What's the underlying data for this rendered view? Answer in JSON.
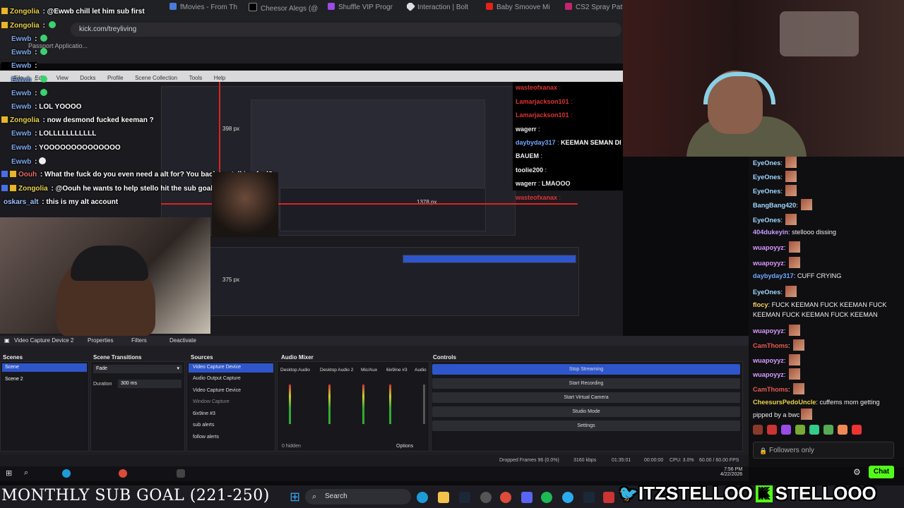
{
  "browser": {
    "tabs": [
      "fMovies - From Th",
      "Cheesor Alegs (@",
      "Shuffle VIP Progr",
      "Interaction | Bolt",
      "Baby Smoove Mi",
      "CS2 Spray Pattern"
    ],
    "url": "kick.com/treyliving",
    "bookmark": "Passport Applicatio..."
  },
  "obs_inner_menu": [
    "File",
    "Edit",
    "View",
    "Docks",
    "Profile",
    "Scene Collection",
    "Tools",
    "Help"
  ],
  "overlay_chat": [
    {
      "user": "Zongolia",
      "sep": " : ",
      "msg": "@Ewwb chill let him sub first",
      "color": "#e8d24a",
      "badge": "yellow"
    },
    {
      "user": "Zongolia",
      "sep": " : ",
      "msg": "",
      "color": "#e8d24a",
      "badge": "yellow"
    },
    {
      "user": "Ewwb",
      "sep": " : ",
      "msg": "",
      "color": "#7da7e8",
      "badge": "none"
    },
    {
      "user": "Ewwb",
      "sep": " : ",
      "msg": "",
      "color": "#7da7e8",
      "badge": "none"
    },
    {
      "user": "Ewwb",
      "sep": " : ",
      "msg": "",
      "color": "#7da7e8",
      "badge": "none"
    },
    {
      "user": "Ewwb",
      "sep": " : ",
      "msg": "",
      "color": "#7da7e8",
      "badge": "none"
    },
    {
      "user": "Ewwb",
      "sep": " : ",
      "msg": "LOL YOOOO",
      "color": "#7da7e8",
      "badge": "none"
    },
    {
      "user": "Zongolia",
      "sep": " : ",
      "msg": "now desmond fucked keeman ?",
      "color": "#e8d24a",
      "badge": "yellow"
    },
    {
      "user": "Ewwb",
      "sep": " : ",
      "msg": "LOLLLLLLLLLLL",
      "color": "#7da7e8",
      "badge": "none"
    },
    {
      "user": "Ewwb",
      "sep": " : ",
      "msg": "YOOOOOOOOOOOOOO",
      "color": "#7da7e8",
      "badge": "none"
    },
    {
      "user": "Ewwb",
      "sep": " : ",
      "msg": "",
      "color": "#7da7e8",
      "badge": "none"
    },
    {
      "user": "Oouh",
      "sep": " : ",
      "msg": "What the fuck do you even need a alt for? You back to stalking feel?",
      "color": "#e86a6a",
      "badge": "blue"
    },
    {
      "user": "Zongolia",
      "sep": " : ",
      "msg": "@Oouh he wants to help stello hit the sub goal",
      "color": "#e8d24a",
      "badge": "yellow"
    },
    {
      "user": "oskars_alt",
      "sep": " : ",
      "msg": "this is my alt account",
      "color": "#9ec1ff",
      "badge": "none"
    }
  ],
  "preview_chat": [
    {
      "user": "wagerr",
      "msg": ""
    },
    {
      "user": "wasteofxanax",
      "msg": ""
    },
    {
      "user": "Lamarjackson101",
      "msg": ""
    },
    {
      "user": "Lamarjackson101",
      "msg": ""
    },
    {
      "user": "wagerr",
      "msg": ""
    },
    {
      "user": "daybyday317",
      "msg": "KEEMAN SEMAN DI"
    },
    {
      "user": "BAUEM",
      "msg": ""
    },
    {
      "user": "toolie200",
      "msg": ""
    },
    {
      "user": "wagerr",
      "msg": "LMAOOO"
    },
    {
      "user": "wasteofxanax",
      "msg": ""
    }
  ],
  "preview_labels": {
    "a": "398 px",
    "b": "1378 px",
    "c": "375 px"
  },
  "right_chat": [
    {
      "user": "EyeOnes",
      "msg": "",
      "color": "#9fd7ff",
      "emote": true
    },
    {
      "user": "EyeOnes",
      "msg": "",
      "color": "#9fd7ff",
      "emote": true
    },
    {
      "user": "EyeOnes",
      "msg": "",
      "color": "#9fd7ff",
      "emote": true
    },
    {
      "user": "BangBang420",
      "msg": "",
      "color": "#9fd7ff",
      "emote": true
    },
    {
      "user": "EyeOnes",
      "msg": "",
      "color": "#9fd7ff",
      "emote": true
    },
    {
      "user": "404dukeyin",
      "msg": "stellooo dissing",
      "color": "#c59cff",
      "emote": false
    },
    {
      "user": "wuapoyyz",
      "msg": "",
      "color": "#d79aff",
      "emote": true
    },
    {
      "user": "wuapoyyz",
      "msg": "",
      "color": "#d79aff",
      "emote": true
    },
    {
      "user": "daybyday317",
      "msg": "CUFF CRYING",
      "color": "#6fa8ff",
      "emote": false
    },
    {
      "user": "EyeOnes",
      "msg": "",
      "color": "#9fd7ff",
      "emote": true
    },
    {
      "user": "flocy",
      "msg": "FUCK KEEMAN FUCK KEEMAN FUCK",
      "color": "#f4d35e",
      "emote": false
    },
    {
      "user": "",
      "msg": "KEEMAN FUCK KEEMAN FUCK KEEMAN",
      "color": "#f4d35e",
      "emote": false
    },
    {
      "user": "wuapoyyz",
      "msg": "",
      "color": "#d79aff",
      "emote": true
    },
    {
      "user": "CamThoms",
      "msg": "",
      "color": "#e8574c",
      "emote": true
    },
    {
      "user": "wuapoyyz",
      "msg": "",
      "color": "#d79aff",
      "emote": true
    },
    {
      "user": "wuapoyyz",
      "msg": "",
      "color": "#d79aff",
      "emote": true
    },
    {
      "user": "CamThoms",
      "msg": "",
      "color": "#e8574c",
      "emote": true
    },
    {
      "user": "CheesursPedoUncle",
      "msg": "cuffems mom getting",
      "color": "#e8d24a",
      "emote": false
    },
    {
      "user": "",
      "msg": "pipped by a bwc",
      "color": "#e8d24a",
      "emote": true
    }
  ],
  "followers_only": "Followers only",
  "chat_button": "Chat",
  "obs": {
    "source_toolbar": [
      "Video Capture Device 2",
      "Properties",
      "Filters",
      "Deactivate"
    ],
    "panes": {
      "scenes": "Scenes",
      "transitions": "Scene Transitions",
      "sources": "Sources",
      "mixer": "Audio Mixer",
      "controls": "Controls"
    },
    "scenes": [
      "Scene",
      "Scene 2"
    ],
    "transition": "Fade",
    "duration_label": "Duration",
    "duration_value": "300 ms",
    "sources": [
      "Video Capture Device",
      "Audio Output Capture",
      "Video Capture Device",
      "Window Capture",
      "6ix9ine #3",
      "sub alerts",
      "follow alerts"
    ],
    "mixer_channels": [
      "Desktop Audio",
      "Desktop Audio 2",
      "Mic/Aux",
      "6ix9ine #3",
      "Audio"
    ],
    "mixer_hidden": "0 hidden",
    "mixer_options": "Options",
    "controls": [
      "Stop Streaming",
      "Start Recording",
      "Start Virtual Camera",
      "Studio Mode",
      "Settings"
    ],
    "status": {
      "dropped": "Dropped Frames 96 (0.0%)",
      "kbps": "3160 kbps",
      "live": "01:35:01",
      "rec": "00:00:00",
      "cpu": "CPU: 3.0%",
      "fps": "60.00 / 60.00 FPS"
    }
  },
  "inner_clock": {
    "time": "7:56 PM",
    "date": "4/22/2026"
  },
  "sub_goal": "MONTHLY SUB GOAL (221-250)",
  "taskbar_search": "Search",
  "socials": {
    "twitter": "ITZSTELLOO",
    "kick": "STELLOOO"
  }
}
